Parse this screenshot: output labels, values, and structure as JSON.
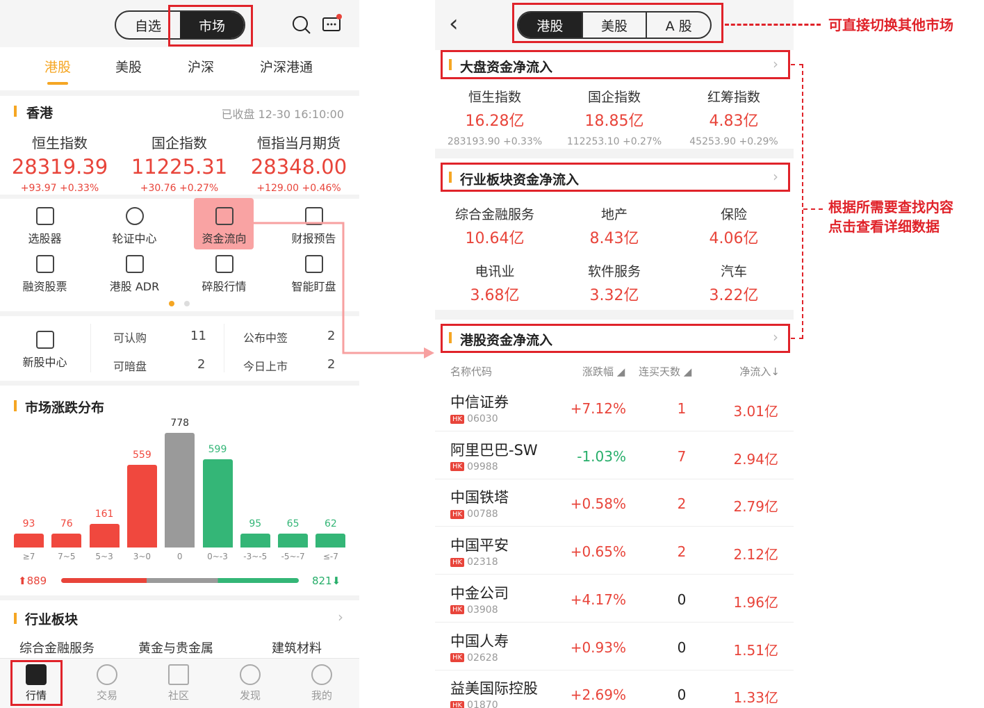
{
  "left": {
    "seg": [
      "自选",
      "市场"
    ],
    "market_tabs": [
      "港股",
      "美股",
      "沪深",
      "沪深港通"
    ],
    "hk": {
      "title": "香港",
      "status": "已收盘 12-30 16:10:00"
    },
    "indices": [
      {
        "name": "恒生指数",
        "value": "28319.39",
        "change": "+93.97 +0.33%"
      },
      {
        "name": "国企指数",
        "value": "11225.31",
        "change": "+30.76 +0.27%"
      },
      {
        "name": "恒指当月期货",
        "value": "28348.00",
        "change": "+129.00 +0.46%"
      }
    ],
    "tools": [
      "选股器",
      "轮证中心",
      "资金流向",
      "财报预告",
      "融资股票",
      "港股 ADR",
      "碎股行情",
      "智能盯盘"
    ],
    "ipo": {
      "label": "新股中心",
      "items": [
        {
          "k": "可认购",
          "v": "11"
        },
        {
          "k": "公布中签",
          "v": "2"
        },
        {
          "k": "可暗盘",
          "v": "2"
        },
        {
          "k": "今日上市",
          "v": "2"
        }
      ]
    },
    "dist_title": "市场涨跌分布",
    "rise_total": "889",
    "fall_total": "821",
    "industry_title": "行业板块",
    "industries": [
      "综合金融服务",
      "黄金与贵金属",
      "建筑材料"
    ],
    "nav": [
      "行情",
      "交易",
      "社区",
      "发现",
      "我的"
    ]
  },
  "chart_data": {
    "type": "bar",
    "categories": [
      "≥7",
      "7~5",
      "5~3",
      "3~0",
      "0",
      "0~-3",
      "-3~-5",
      "-5~-7",
      "≤-7"
    ],
    "values": [
      93,
      76,
      161,
      559,
      778,
      599,
      95,
      65,
      62
    ],
    "colors": [
      "#f0483e",
      "#f0483e",
      "#f0483e",
      "#f0483e",
      "#9a9a9a",
      "#34b677",
      "#34b677",
      "#34b677",
      "#34b677"
    ]
  },
  "right": {
    "seg": [
      "港股",
      "美股",
      "A 股"
    ],
    "sec1": "大盘资金净流入",
    "big": [
      {
        "name": "恒生指数",
        "value": "16.28亿",
        "sub": "283193.90 +0.33%"
      },
      {
        "name": "国企指数",
        "value": "18.85亿",
        "sub": "112253.10 +0.27%"
      },
      {
        "name": "红筹指数",
        "value": "4.83亿",
        "sub": "45253.90 +0.29%"
      }
    ],
    "sec2": "行业板块资金净流入",
    "ind": [
      {
        "name": "综合金融服务",
        "value": "10.64亿"
      },
      {
        "name": "地产",
        "value": "8.43亿"
      },
      {
        "name": "保险",
        "value": "4.06亿"
      },
      {
        "name": "电讯业",
        "value": "3.68亿"
      },
      {
        "name": "软件服务",
        "value": "3.32亿"
      },
      {
        "name": "汽车",
        "value": "3.22亿"
      }
    ],
    "sec3": "港股资金净流入",
    "headers": [
      "名称代码",
      "涨跌幅",
      "连买天数",
      "净流入"
    ],
    "rows": [
      {
        "name": "中信证券",
        "code": "06030",
        "chg": "+7.12%",
        "days": "1",
        "net": "3.01亿"
      },
      {
        "name": "阿里巴巴-SW",
        "code": "09988",
        "chg": "-1.03%",
        "days": "7",
        "net": "2.94亿"
      },
      {
        "name": "中国铁塔",
        "code": "00788",
        "chg": "+0.58%",
        "days": "2",
        "net": "2.79亿"
      },
      {
        "name": "中国平安",
        "code": "02318",
        "chg": "+0.65%",
        "days": "2",
        "net": "2.12亿"
      },
      {
        "name": "中金公司",
        "code": "03908",
        "chg": "+4.17%",
        "days": "0",
        "net": "1.96亿"
      },
      {
        "name": "中国人寿",
        "code": "02628",
        "chg": "+0.93%",
        "days": "0",
        "net": "1.51亿"
      },
      {
        "name": "益美国际控股",
        "code": "01870",
        "chg": "+2.69%",
        "days": "0",
        "net": "1.33亿"
      }
    ]
  },
  "annotations": {
    "a1": "可直接切换其他市场",
    "a2": "根据所需要查找内容",
    "a3": "点击查看详细数据"
  }
}
